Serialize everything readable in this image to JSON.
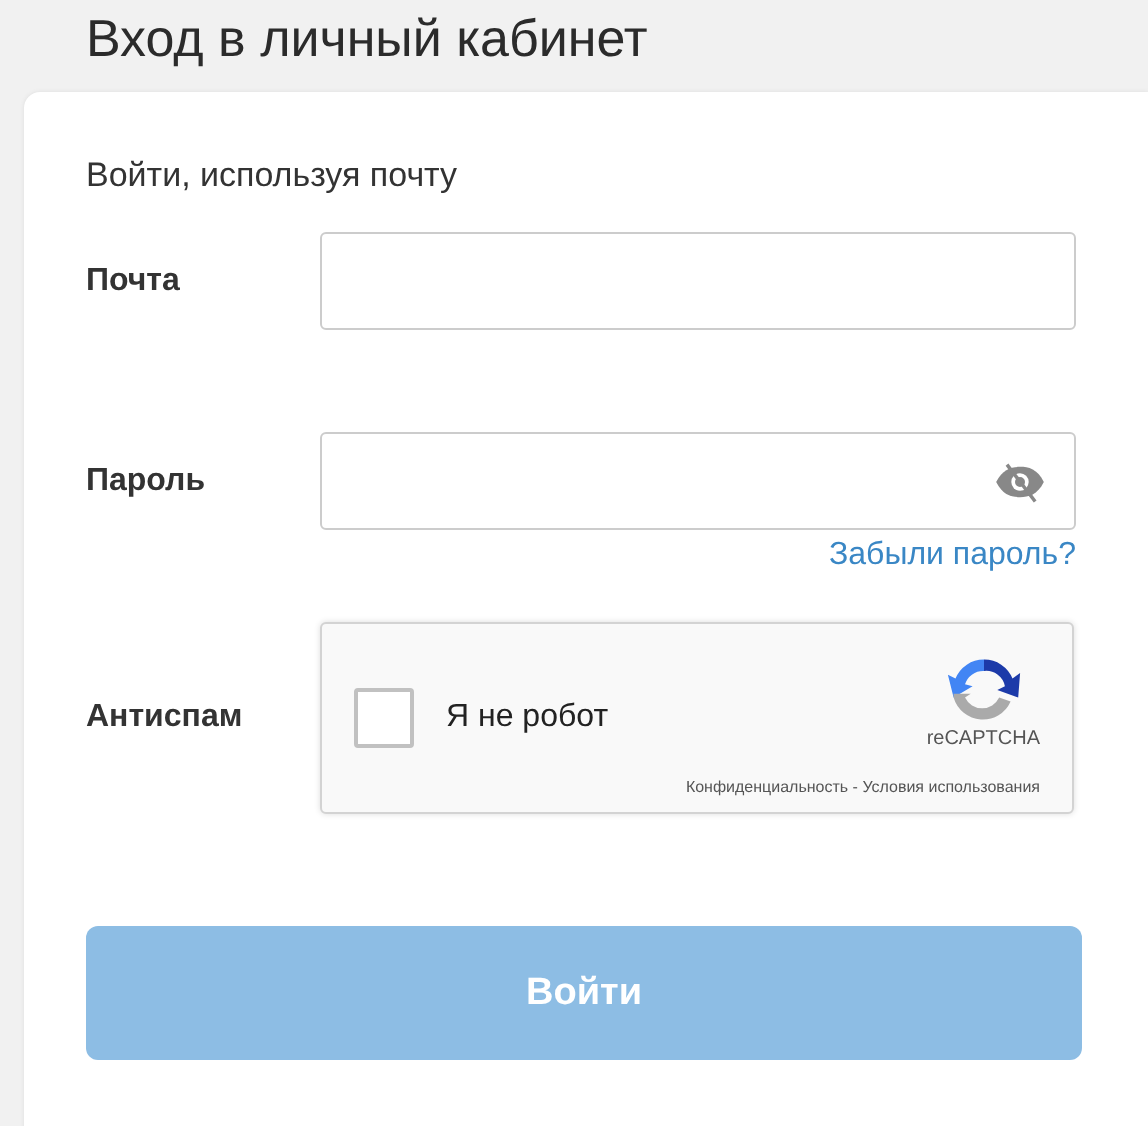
{
  "title": "Вход в личный кабинет",
  "subtitle": "Войти, используя почту",
  "fields": [
    {
      "kind": "text",
      "label": "Почта"
    },
    {
      "kind": "password",
      "label": "Пароль",
      "password_visible": false,
      "link": "Забыли пароль?"
    }
  ],
  "antispam": {
    "label": "Антиспам",
    "checkbox_label": "Я не робот",
    "checked": false,
    "brand": "reCAPTCHA",
    "footer": "Конфиденциальность - Условия использования"
  },
  "submit": {
    "label": "Войти",
    "disabled": true
  }
}
